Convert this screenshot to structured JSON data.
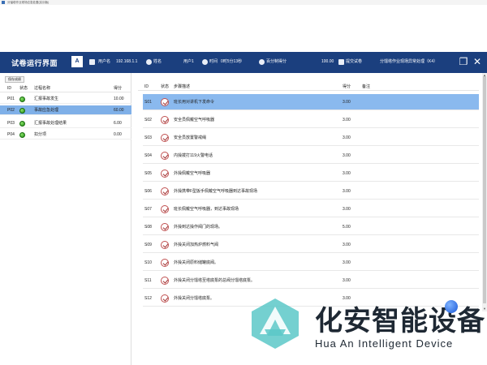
{
  "window": {
    "title": "分馏塔作业现场应急处置(实训版)"
  },
  "header": {
    "app_title": "试卷运行界面",
    "logo_text": "A",
    "user_label": "用户名",
    "user_value": "192.168.1.1",
    "name_label": "姓名",
    "name_value": "用户1",
    "time_label": "时间",
    "time_value": "0时5分13秒",
    "score_label": "百分制得分",
    "score_value": "100.00",
    "submit_label": "提交试卷",
    "course_title": "分馏塔作业现场异常处理（K4）",
    "restore_icon": "restore-window-icon",
    "close_icon": "close-icon",
    "accent_color": "#1b3f7e"
  },
  "left": {
    "save_label": "保存成绩",
    "columns": {
      "id": "ID",
      "status": "状态",
      "name": "过程名称",
      "score": "得分"
    },
    "rows": [
      {
        "id": "P01",
        "name": "汇报事故发生",
        "score": "10.00"
      },
      {
        "id": "P02",
        "name": "事故应急处理",
        "score": "60.00",
        "selected": true
      },
      {
        "id": "P03",
        "name": "汇报事故处理结果",
        "score": "6.00"
      },
      {
        "id": "P04",
        "name": "扣分项",
        "score": "0.00"
      }
    ]
  },
  "right": {
    "columns": {
      "id": "ID",
      "status": "状态",
      "desc": "步骤描述",
      "score": "得分",
      "note": "备注"
    },
    "rows": [
      {
        "id": "S01",
        "desc": "班长用对讲机下发命令",
        "score": "3.00",
        "selected": true
      },
      {
        "id": "S02",
        "desc": "安全员佩戴空气呼吸器",
        "score": "3.00"
      },
      {
        "id": "S03",
        "desc": "安全员放置警戒绳",
        "score": "3.00"
      },
      {
        "id": "S04",
        "desc": "内操拨打119火警电话",
        "score": "3.00"
      },
      {
        "id": "S05",
        "desc": "外操佩戴空气呼吸器",
        "score": "3.00"
      },
      {
        "id": "S06",
        "desc": "外操携带F型扳手佩戴空气呼吸器到达事故现场",
        "score": "3.00"
      },
      {
        "id": "S07",
        "desc": "班长佩戴空气呼吸器，到达事故现场",
        "score": "3.00"
      },
      {
        "id": "S08",
        "desc": "外操到达操作阀门的现场。",
        "score": "5.00"
      },
      {
        "id": "S09",
        "desc": "外操关闭加热炉燃料气阀",
        "score": "3.00"
      },
      {
        "id": "S10",
        "desc": "外操关闭原料储罐底阀。",
        "score": "3.00"
      },
      {
        "id": "S11",
        "desc": "外操关闭分馏塔至塔底泵的总阀分馏塔底泵。",
        "score": "3.00"
      },
      {
        "id": "S12",
        "desc": "外操关闭分馏塔底泵。",
        "score": "3.00"
      }
    ]
  },
  "watermark": {
    "cn": "化安智能设备",
    "en": "Hua An Intelligent Device",
    "brand_color": "#5cc8c8"
  }
}
